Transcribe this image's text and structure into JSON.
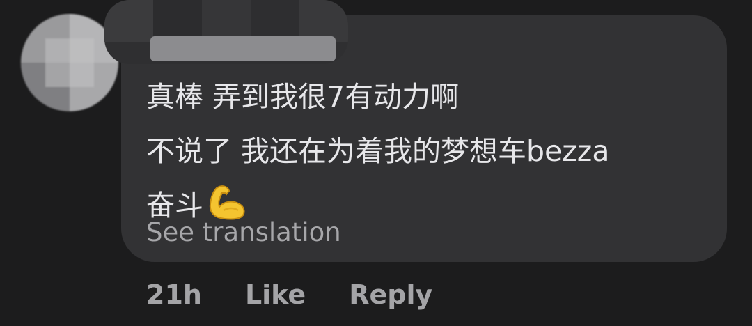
{
  "comment": {
    "lines": [
      "真棒 弄到我很7有动力啊",
      "不说了 我还在为着我的梦想车bezza",
      "奋斗"
    ],
    "emoji": "flexed-biceps-icon",
    "see_translation": "See translation"
  },
  "actions": {
    "time": "21h",
    "like_label": "Like",
    "reply_label": "Reply"
  },
  "colors": {
    "background": "#1c1c1d",
    "bubble": "#323234",
    "text": "#e7e7ea",
    "secondary_text": "#a7a7aa"
  }
}
